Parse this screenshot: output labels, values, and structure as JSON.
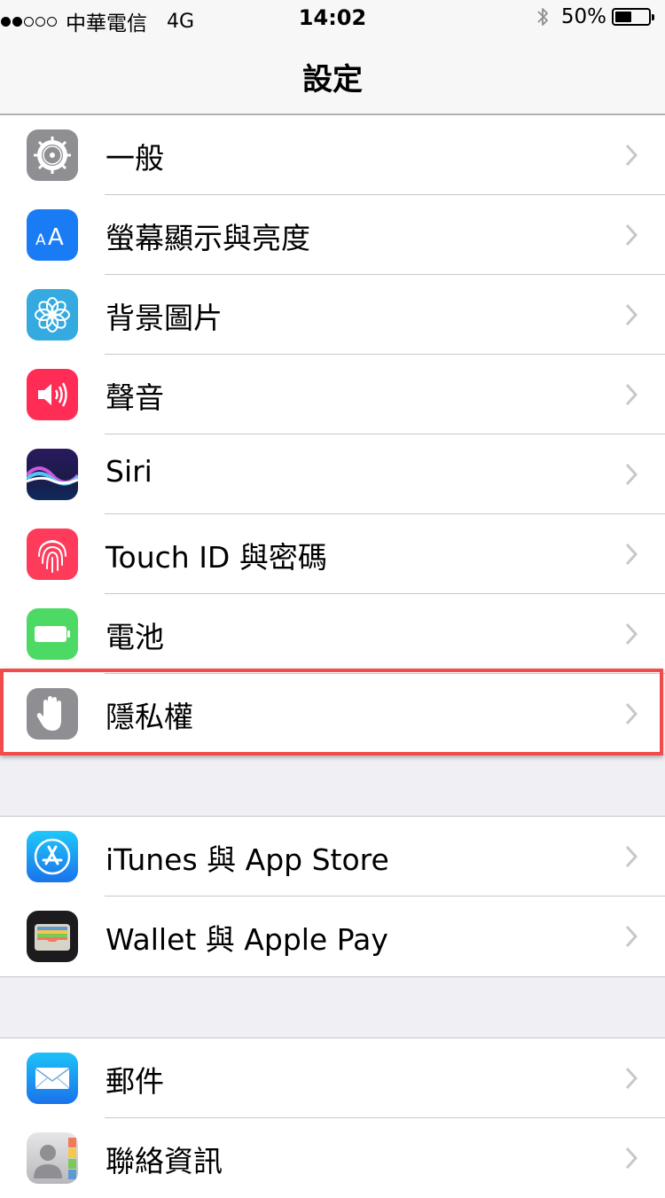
{
  "status_bar": {
    "carrier": "中華電信",
    "network": "4G",
    "time": "14:02",
    "battery_percent": "50%",
    "battery_level": 0.5,
    "signal_bars": 2,
    "signal_total": 5
  },
  "nav": {
    "title": "設定"
  },
  "groups": [
    {
      "items": [
        {
          "label": "一般",
          "icon": "gear-icon",
          "color": "#8e8e93"
        },
        {
          "label": "螢幕顯示與亮度",
          "icon": "text-size-icon",
          "color": "#1a7cf5"
        },
        {
          "label": "背景圖片",
          "icon": "flower-icon",
          "color": "#35aae0"
        },
        {
          "label": "聲音",
          "icon": "speaker-icon",
          "color": "#ff2d55"
        },
        {
          "label": "Siri",
          "icon": "siri-icon",
          "color": "#1b1b4a"
        },
        {
          "label": "Touch ID 與密碼",
          "icon": "fingerprint-icon",
          "color": "#ff3b5b"
        },
        {
          "label": "電池",
          "icon": "battery-icon",
          "color": "#4cd964"
        },
        {
          "label": "隱私權",
          "icon": "hand-icon",
          "color": "#8e8e93",
          "highlighted": true
        }
      ]
    },
    {
      "items": [
        {
          "label": "iTunes 與 App Store",
          "icon": "app-store-icon",
          "color": "#1e9bf0"
        },
        {
          "label": "Wallet 與 Apple Pay",
          "icon": "wallet-icon",
          "color": "#1c1c1e"
        }
      ]
    },
    {
      "items": [
        {
          "label": "郵件",
          "icon": "mail-icon",
          "color": "#1e8cf0"
        },
        {
          "label": "聯絡資訊",
          "icon": "contacts-icon",
          "color": "#9a9a9e"
        }
      ]
    }
  ],
  "highlight_color": "#f24b4b"
}
